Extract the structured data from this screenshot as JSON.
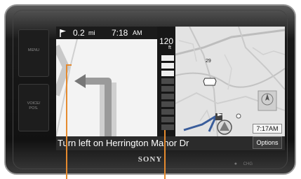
{
  "side_buttons": [
    {
      "label": "MENU"
    },
    {
      "label_top": "VOICE/",
      "label_bottom": "POS."
    }
  ],
  "nav": {
    "distance_value": "0.2",
    "distance_unit": "mi",
    "eta_time": "7:18",
    "eta_period": "AM",
    "speed_limit": "120",
    "speed_unit": "ft",
    "route_shield": "29",
    "clock": "7:17AM",
    "instruction": "Turn left on Herrington Manor Dr",
    "options_label": "Options"
  },
  "brand": "SONY",
  "bottom_labels": {
    "power": "●",
    "chg": "CHG"
  },
  "colors": {
    "callout": "#e58a2e",
    "route_blue": "#3a5d9b",
    "meter_active": "#efefef",
    "meter_inactive": "#4a4a4a"
  },
  "icons": [
    "flag-icon",
    "turn-left-arrow-icon",
    "compass-icon",
    "vehicle-position-icon",
    "route-shield-icon"
  ]
}
